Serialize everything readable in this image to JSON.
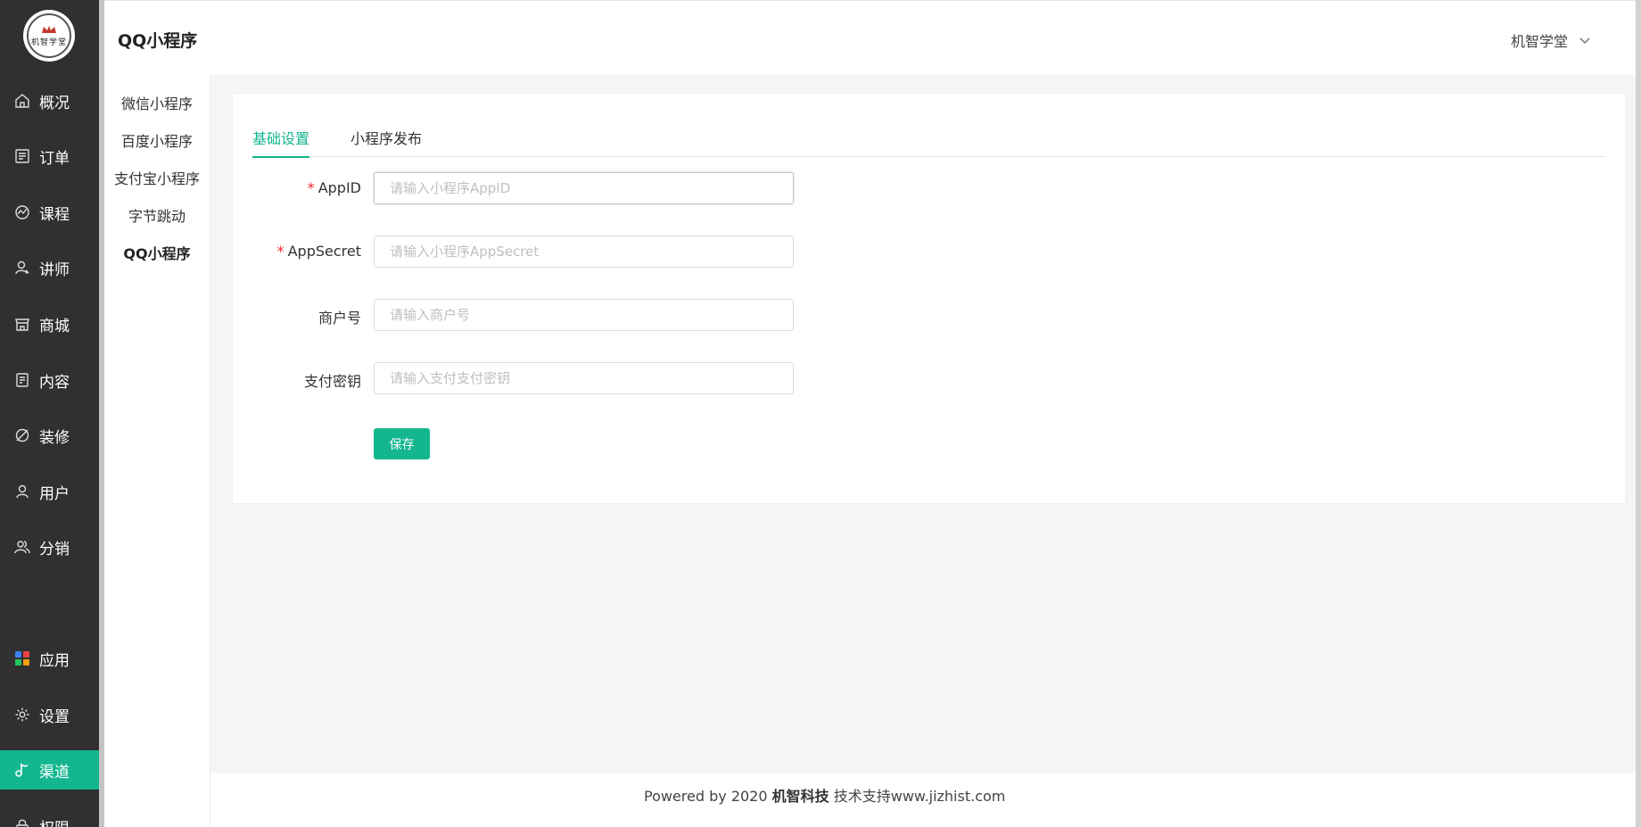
{
  "app": {
    "logo_text": "机智学堂"
  },
  "sidebar": {
    "items": [
      {
        "label": "概况",
        "icon": "home-icon"
      },
      {
        "label": "订单",
        "icon": "order-icon"
      },
      {
        "label": "课程",
        "icon": "course-icon"
      },
      {
        "label": "讲师",
        "icon": "teacher-icon"
      },
      {
        "label": "商城",
        "icon": "store-icon"
      },
      {
        "label": "内容",
        "icon": "content-icon"
      },
      {
        "label": "装修",
        "icon": "decorate-icon"
      },
      {
        "label": "用户",
        "icon": "user-icon"
      },
      {
        "label": "分销",
        "icon": "distribution-icon"
      },
      {
        "label": "应用",
        "icon": "apps-icon"
      },
      {
        "label": "设置",
        "icon": "settings-icon"
      },
      {
        "label": "渠道",
        "icon": "channel-icon",
        "active": true
      },
      {
        "label": "权限",
        "icon": "permission-icon"
      }
    ]
  },
  "subnav": {
    "items": [
      "微信小程序",
      "百度小程序",
      "支付宝小程序",
      "字节跳动",
      "QQ小程序"
    ],
    "active": "QQ小程序"
  },
  "header": {
    "title": "QQ小程序",
    "user": "机智学堂"
  },
  "tabs": [
    {
      "label": "基础设置",
      "active": true
    },
    {
      "label": "小程序发布"
    }
  ],
  "form": {
    "fields": [
      {
        "label": "AppID",
        "required": true,
        "value": "",
        "placeholder": "请输入小程序AppID"
      },
      {
        "label": "AppSecret",
        "required": true,
        "value": "",
        "placeholder": "请输入小程序AppSecret"
      },
      {
        "label": "商户号",
        "required": false,
        "value": "",
        "placeholder": "请输入商户号"
      },
      {
        "label": "支付密钥",
        "required": false,
        "value": "",
        "placeholder": "请输入支付支付密钥"
      }
    ],
    "save_label": "保存"
  },
  "footer": {
    "prefix": "Powered by 2020",
    "company": "机智科技",
    "suffix": "技术支持www.jizhist.com"
  },
  "colors": {
    "accent": "#13b68f",
    "sidebar_bg": "#303030",
    "required": "#f5222d"
  }
}
